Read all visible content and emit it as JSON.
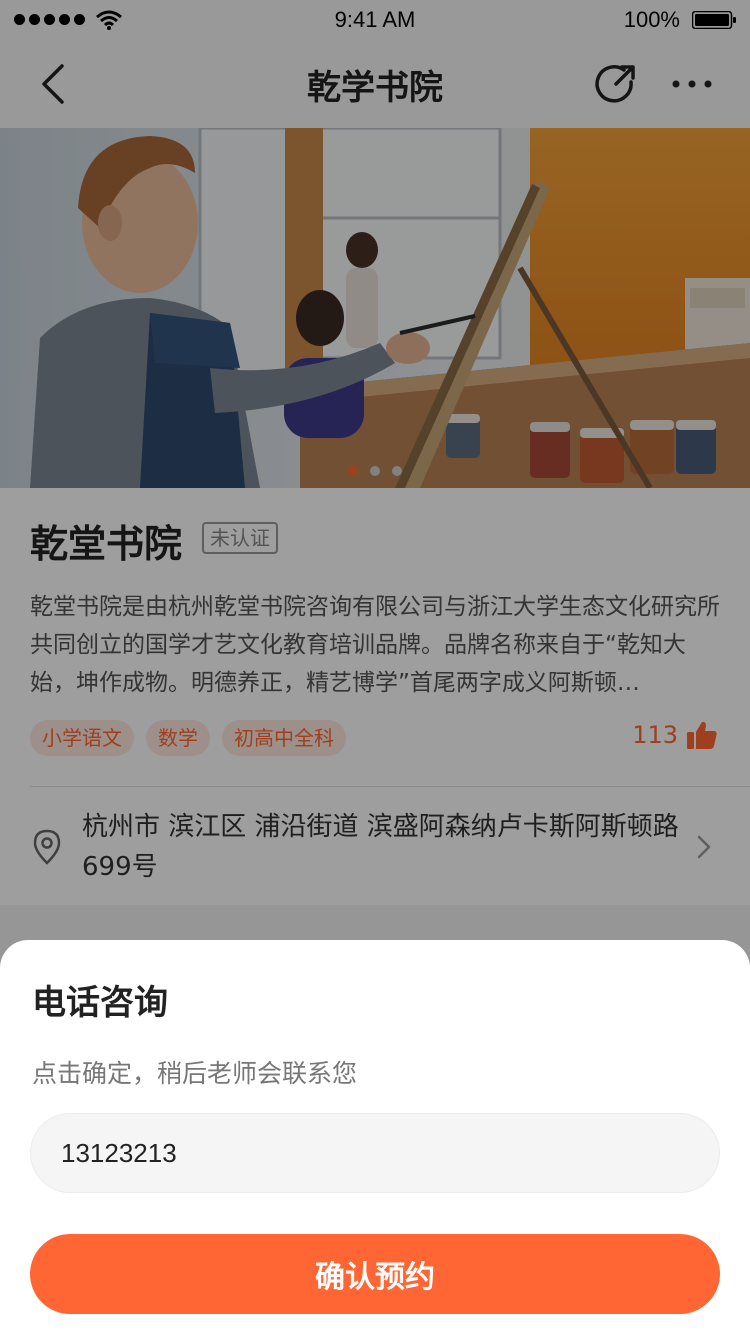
{
  "status_bar": {
    "time": "9:41 AM",
    "battery": "100%"
  },
  "nav": {
    "title": "乾学书院"
  },
  "carousel": {
    "slide_count": 3,
    "active_index": 0
  },
  "school": {
    "name": "乾堂书院",
    "cert_status": "未认证",
    "description": "乾堂书院是由杭州乾堂书院咨询有限公司与浙江大学生态文化研究所共同创立的国学才艺文化教育培训品牌。品牌名称来自于“乾知大始，坤作成物。明德养正，精艺博学”首尾两字成义阿斯顿…",
    "tags": [
      "小学语文",
      "数学",
      "初高中全科"
    ],
    "likes": "113",
    "address": "杭州市 滨江区 浦沿街道 滨盛阿森纳卢卡斯阿斯顿路699号"
  },
  "sheet": {
    "title": "电话咨询",
    "subtitle": "点击确定，稍后老师会联系您",
    "phone_value": "13123213",
    "confirm_label": "确认预约"
  },
  "colors": {
    "accent": "#ff6633",
    "tag_bg": "#fde8e0"
  }
}
